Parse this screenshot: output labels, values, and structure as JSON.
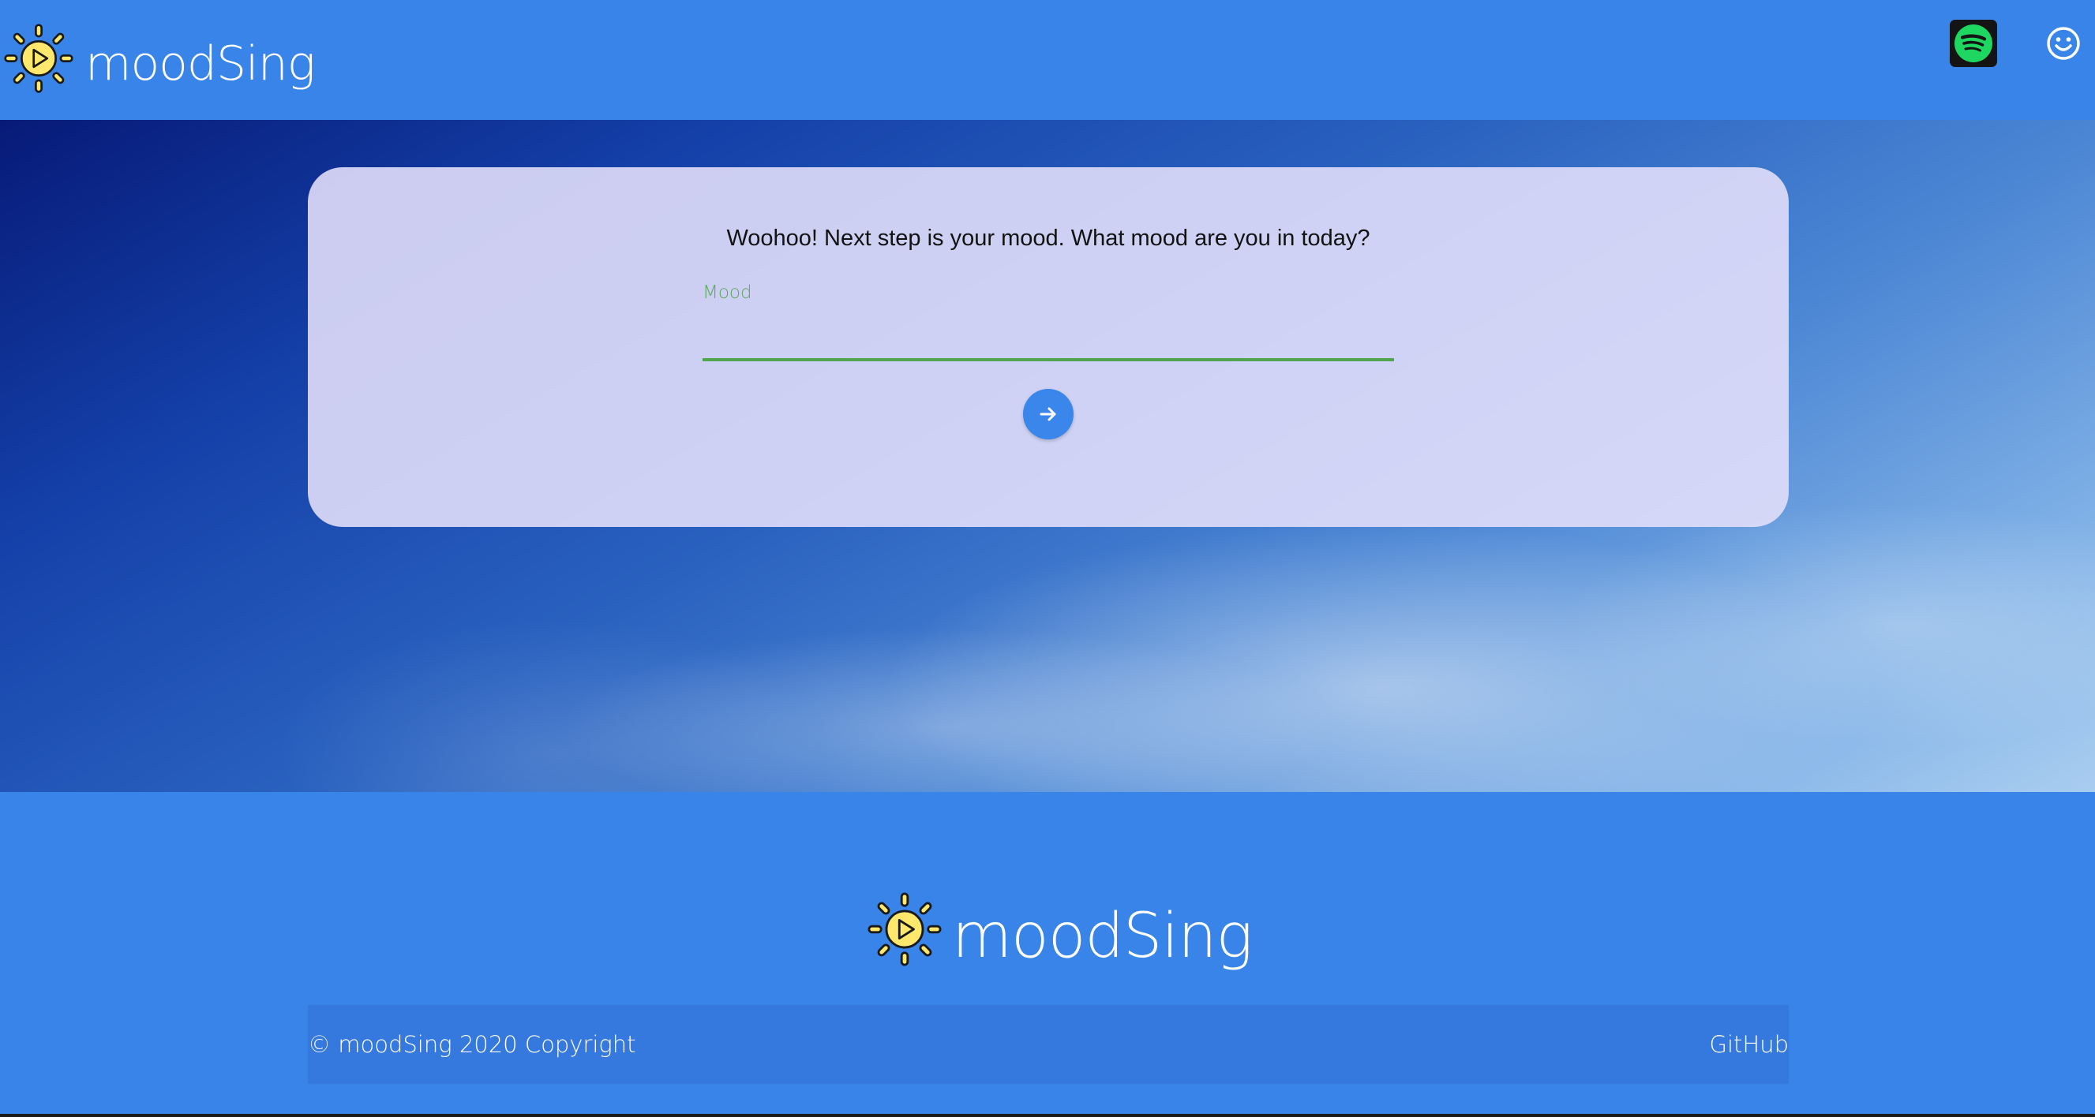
{
  "navbar": {
    "brand_name": "moodSing",
    "spotify_icon": "spotify-icon",
    "profile_icon": "smiley-face-icon"
  },
  "card": {
    "prompt": "Woohoo! Next step is your mood. What mood are you in today?",
    "mood_field": {
      "label": "Mood",
      "value": "",
      "placeholder": ""
    },
    "submit_icon": "arrow-right-icon"
  },
  "footer": {
    "brand_name": "moodSing",
    "copyright": "© moodSing 2020 Copyright",
    "github_label": "GitHub"
  },
  "colors": {
    "primary": "#3884e8",
    "logo_yellow": "#ffe86b",
    "accent_green": "#4fa64f",
    "spotify_green": "#1ed760",
    "card_bg": "#e1defa"
  }
}
